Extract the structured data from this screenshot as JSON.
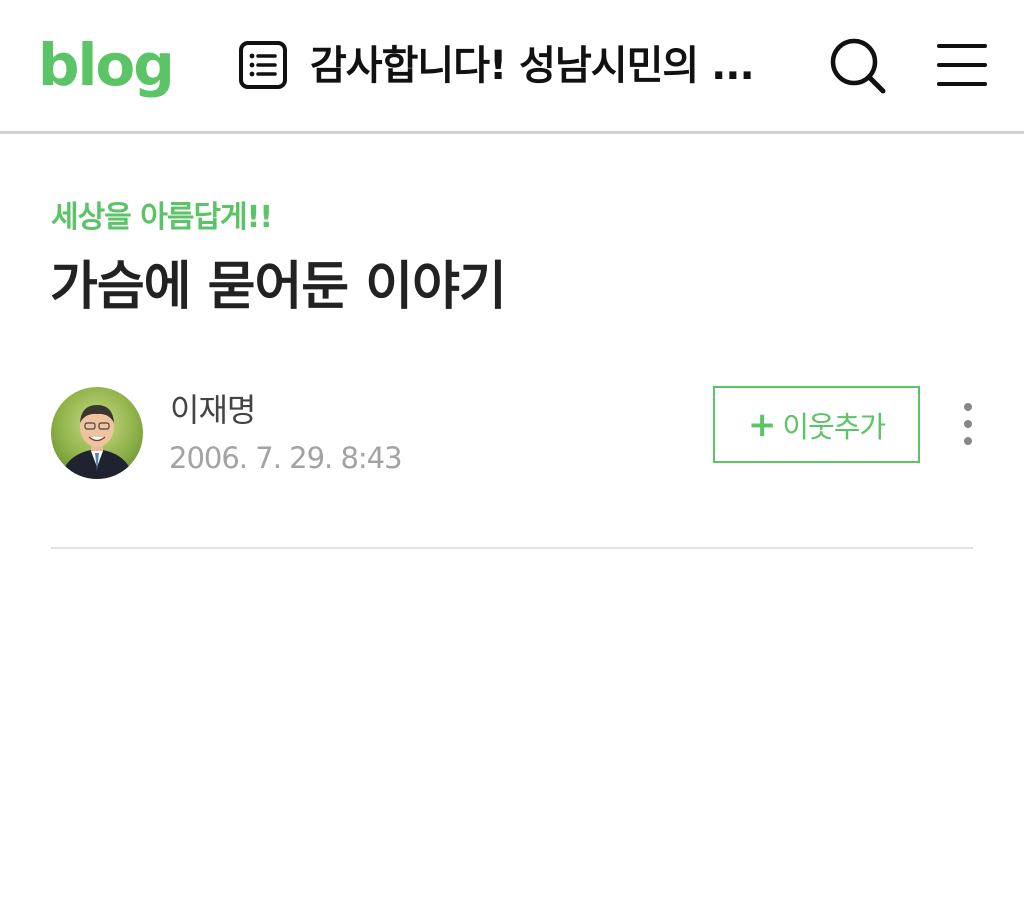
{
  "header": {
    "logo_text": "blog",
    "title": "감사합니다! 성남시민의 ...",
    "icons": {
      "post_list": "post-list-icon",
      "search": "search-icon",
      "menu": "hamburger-menu-icon"
    }
  },
  "post": {
    "category": "세상을 아름답게!!",
    "title": "가슴에 묻어둔 이야기",
    "author": {
      "name": "이재명",
      "date": "2006. 7. 29. 8:43"
    },
    "neighbor_button": {
      "plus": "+",
      "label": "이웃추가"
    }
  },
  "colors": {
    "brand_green": "#5ac466",
    "title_text": "#222222",
    "date_text": "#a3a3a3",
    "divider": "#e3e3e3"
  }
}
